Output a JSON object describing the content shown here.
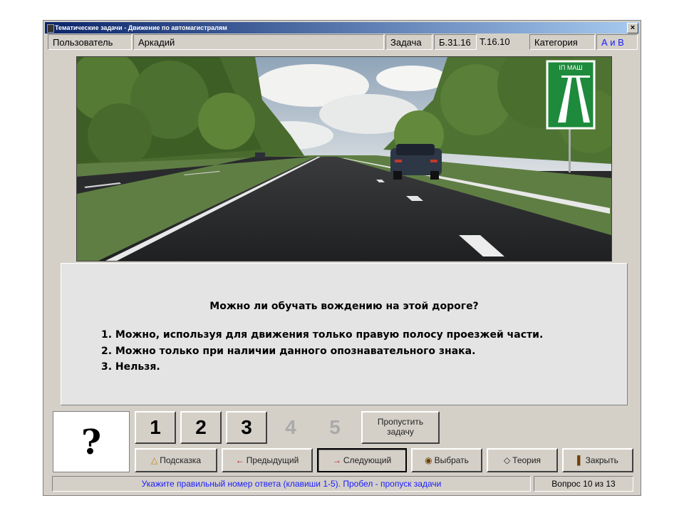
{
  "window": {
    "title": "Тематические задачи - Движение по автомагистралям",
    "close_label": "×"
  },
  "infobar": {
    "user_label": "Пользователь",
    "user_name": "Аркадий",
    "task_label": "Задача",
    "ticket": "Б.31.16",
    "topic": "Т.16.10",
    "category_label": "Категория",
    "category_value": "А и В"
  },
  "scene": {
    "sign_caption": "ІП МАШ"
  },
  "question": {
    "text": "Можно ли обучать вождению на этой дороге?",
    "answers": [
      "1. Можно, используя для движения только правую полосу проезжей части.",
      "2. Можно только при наличии данного опознавательного знака.",
      "3. Нельзя."
    ]
  },
  "answer_indicator": "?",
  "answer_buttons": [
    "1",
    "2",
    "3",
    "4",
    "5"
  ],
  "skip_button": {
    "line1": "Пропустить",
    "line2": "задачу"
  },
  "toolbar": {
    "hint": "Подсказка",
    "prev": "Предыдущий",
    "next": "Следующий",
    "choose": "Выбрать",
    "theory": "Теория",
    "close": "Закрыть"
  },
  "icons": {
    "hint": "lightbulb-icon",
    "prev": "arrow-left-icon",
    "next": "arrow-right-icon",
    "choose": "select-icon",
    "theory": "theory-icon",
    "close": "exit-door-icon"
  },
  "status": {
    "message": "Укажите правильный номер ответа (клавиши 1-5). Пробел - пропуск задачи",
    "progress": "Вопрос 10 из 13"
  },
  "colors": {
    "title_start": "#0a246a",
    "title_end": "#a6caf0",
    "status_text": "#1a1aff",
    "sign_green": "#1e8a3c"
  }
}
